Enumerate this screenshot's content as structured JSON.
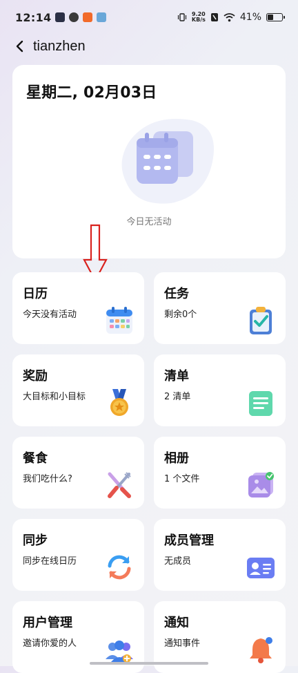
{
  "status": {
    "time": "12:14",
    "net_speed_value": "9.20",
    "net_speed_unit": "KB/s",
    "battery": "41%",
    "battery_level": 0.41
  },
  "header": {
    "title": "tianzhen"
  },
  "date_card": {
    "date": "星期二, 02月03日",
    "empty_text": "今日无活动"
  },
  "cards": [
    {
      "title": "日历",
      "subtitle": "今天没有活动",
      "icon": "calendar-icon"
    },
    {
      "title": "任务",
      "subtitle": "剩余0个",
      "icon": "task-clipboard-icon"
    },
    {
      "title": "奖励",
      "subtitle": "大目标和小目标",
      "icon": "medal-icon"
    },
    {
      "title": "清单",
      "subtitle": "2 清单",
      "icon": "list-icon"
    },
    {
      "title": "餐食",
      "subtitle": "我们吃什么?",
      "icon": "fork-knife-icon"
    },
    {
      "title": "相册",
      "subtitle": "1 个文件",
      "icon": "photo-album-icon"
    },
    {
      "title": "同步",
      "subtitle": "同步在线日历",
      "icon": "sync-icon"
    },
    {
      "title": "成员管理",
      "subtitle": "无成员",
      "icon": "member-card-icon"
    },
    {
      "title": "用户管理",
      "subtitle": "邀请你爱的人",
      "icon": "users-icon"
    },
    {
      "title": "通知",
      "subtitle": "通知事件",
      "icon": "bell-icon"
    }
  ]
}
